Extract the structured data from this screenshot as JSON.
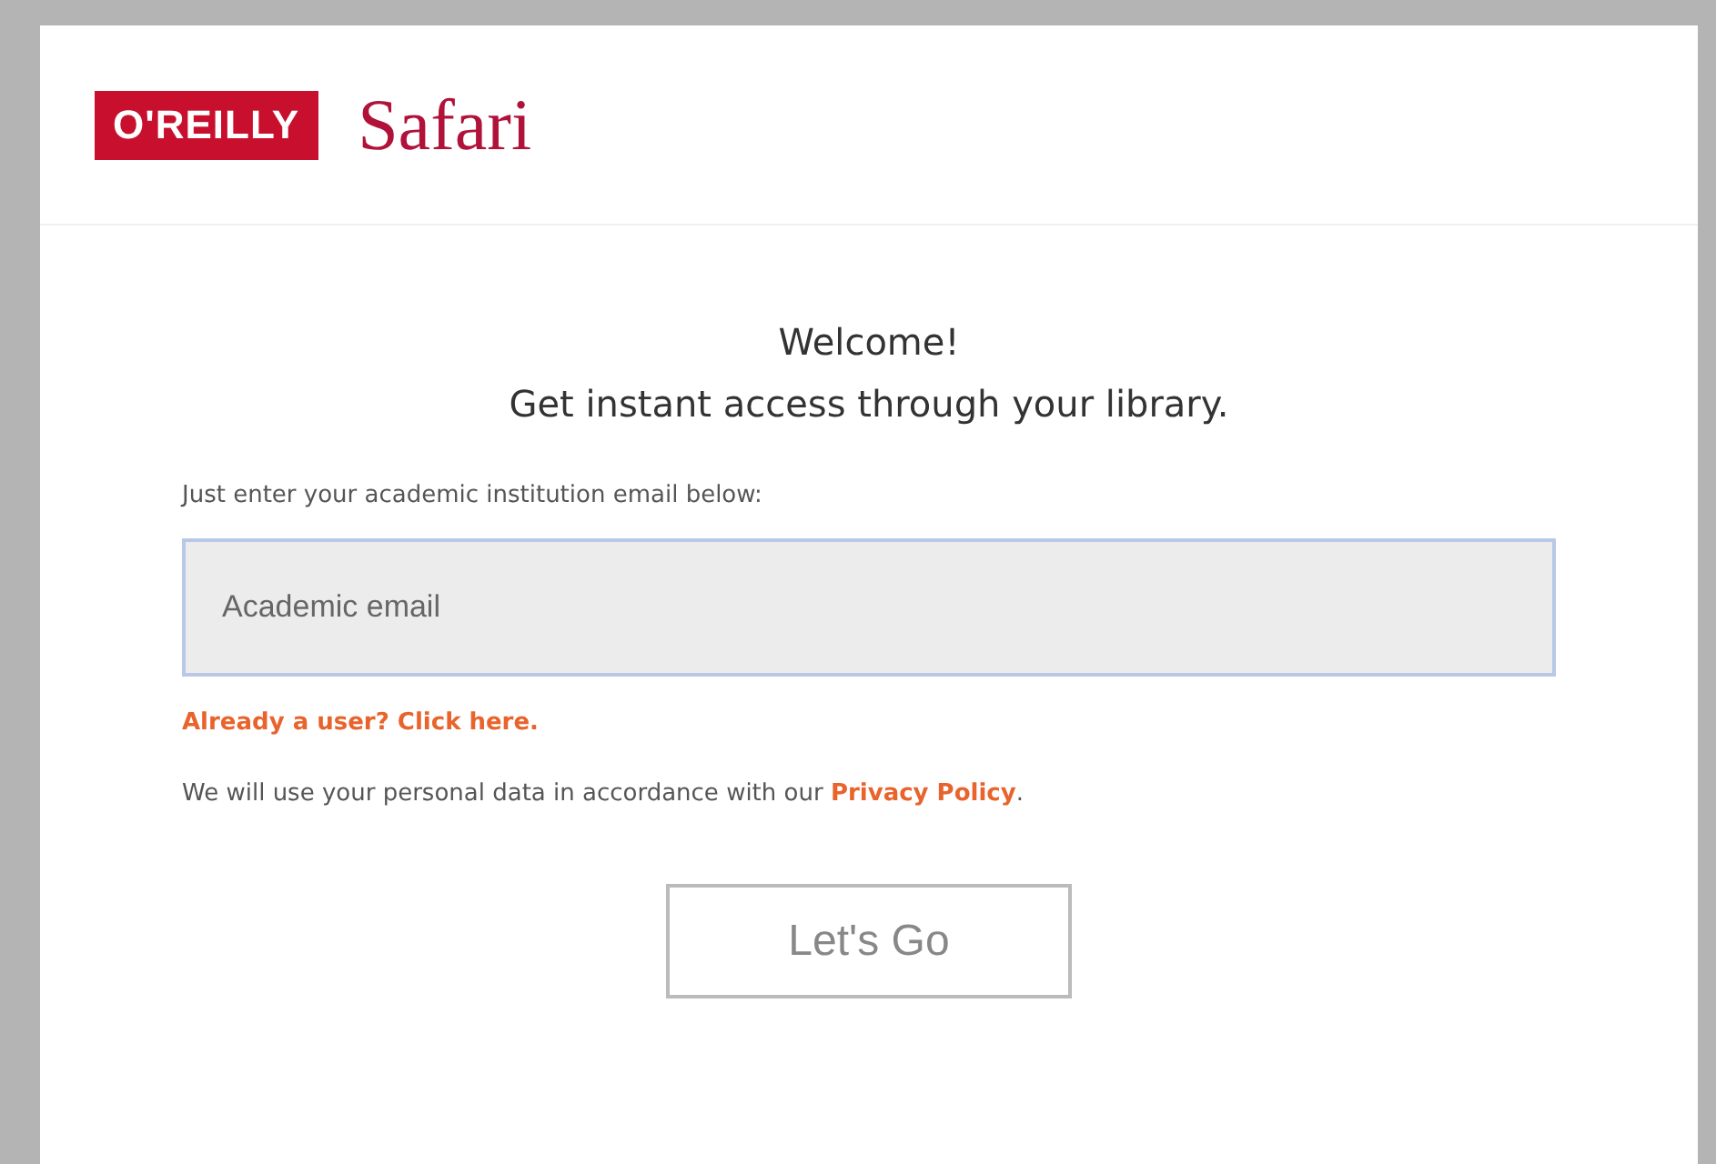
{
  "logo": {
    "badge": "O'REILLY",
    "product": "Safari"
  },
  "heading": {
    "line_1": "Welcome!",
    "line_2": "Get instant access through your library."
  },
  "email_field": {
    "label": "Just enter your academic institution email below:",
    "placeholder": "Academic email"
  },
  "existing_user_link": "Already a user? Click here.",
  "privacy_notice": {
    "text": "We will use your personal data in accordance with our ",
    "link": "Privacy Policy",
    "after": "."
  },
  "submit_button": "Let's Go"
}
